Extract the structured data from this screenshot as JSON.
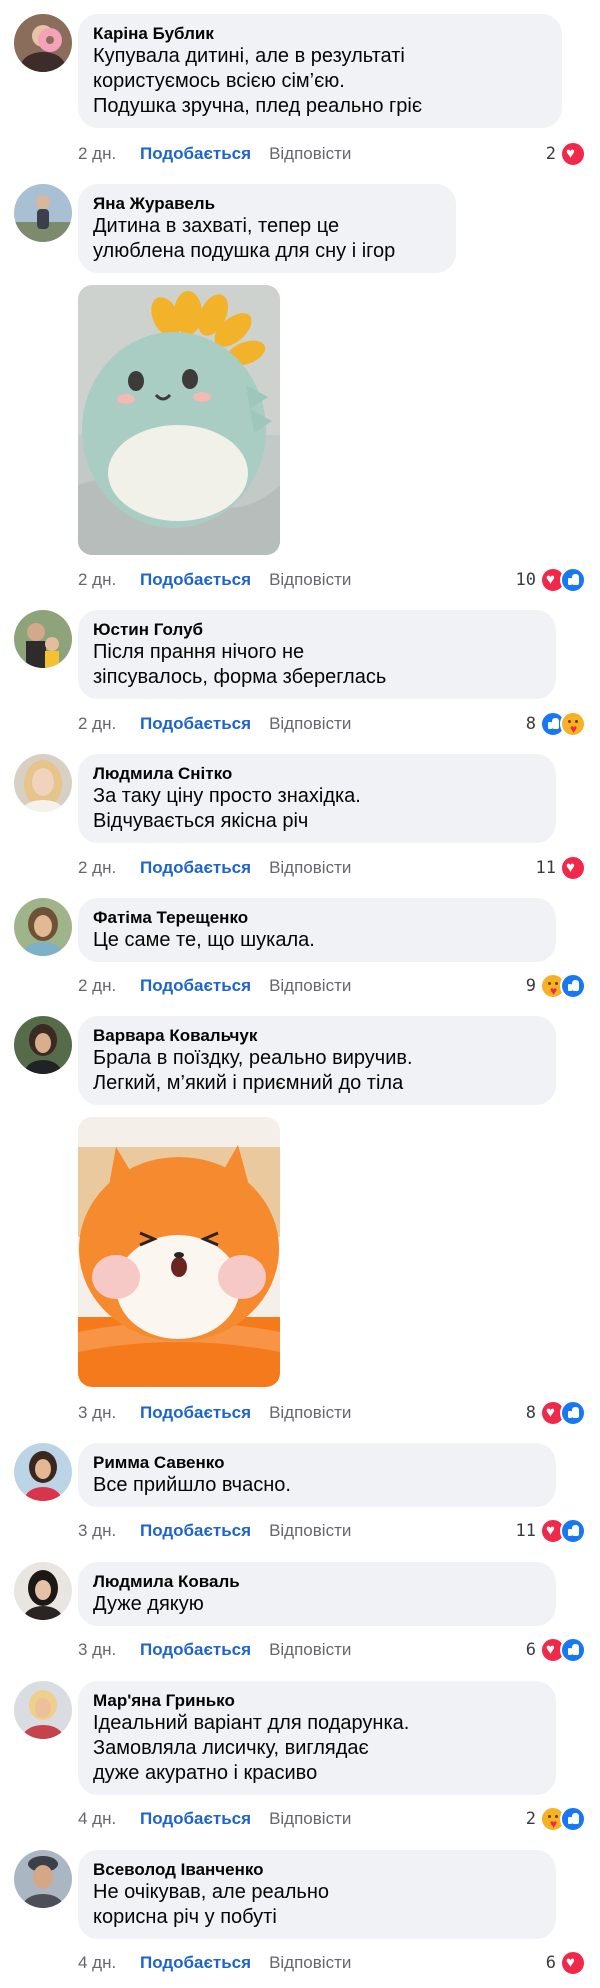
{
  "ui": {
    "like_label": "Подобається",
    "reply_label": "Відповісти"
  },
  "comments": [
    {
      "author": "Каріна Бублик",
      "lines": [
        "Купувала дитині, але в результаті",
        "користуємось всією сім’єю.",
        "Подушка зручна, плед реально гріє"
      ],
      "time": "2 дн.",
      "count": "2",
      "reactions": [
        "heart-icon"
      ]
    },
    {
      "author": "Яна Журавель",
      "lines": [
        "Дитина в захваті, тепер це",
        "улюблена подушка для сну і ігор"
      ],
      "time": "2 дн.",
      "count": "10",
      "reactions": [
        "heart-icon",
        "like-icon"
      ],
      "photo": "mint-dinosaur-plush"
    },
    {
      "author": "Юстин Голуб",
      "lines": [
        "Після прання нічого не",
        "зіпсувалось, форма збереглась"
      ],
      "time": "2 дн.",
      "count": "8",
      "reactions": [
        "like-icon",
        "care-icon"
      ]
    },
    {
      "author": "Людмила Снітко",
      "lines": [
        "За таку ціну просто знахідка.",
        "Відчувається якісна річ"
      ],
      "time": "2 дн.",
      "count": "11",
      "reactions": [
        "heart-icon"
      ]
    },
    {
      "author": "Фатіма Терещенко",
      "lines": [
        "Це саме те, що шукала."
      ],
      "time": "2 дн.",
      "count": "9",
      "reactions": [
        "care-icon",
        "like-icon"
      ]
    },
    {
      "author": "Варвара Ковальчук",
      "lines": [
        "Брала в поїздку, реально виручив.",
        "Легкий, м’який і приємний до тіла"
      ],
      "time": "3 дн.",
      "count": "8",
      "reactions": [
        "heart-icon",
        "like-icon"
      ],
      "photo": "orange-fox-plush"
    },
    {
      "author": "Римма Савенко",
      "lines": [
        "Все прийшло вчасно."
      ],
      "time": "3 дн.",
      "count": "11",
      "reactions": [
        "heart-icon",
        "like-icon"
      ]
    },
    {
      "author": "Людмила Коваль",
      "lines": [
        "Дуже дякую"
      ],
      "time": "3 дн.",
      "count": "6",
      "reactions": [
        "heart-icon",
        "like-icon"
      ]
    },
    {
      "author": "Мар'яна Гринько",
      "lines": [
        "Ідеальний варіант для подарунка.",
        "Замовляла лисичку, виглядає",
        "дуже акуратно і красиво"
      ],
      "time": "4 дн.",
      "count": "2",
      "reactions": [
        "care-icon",
        "like-icon"
      ]
    },
    {
      "author": "Всеволод Іванченко",
      "lines": [
        "Не очікував, але реально",
        "корисна річ у побуті"
      ],
      "time": "4 дн.",
      "count": "6",
      "reactions": [
        "heart-icon"
      ]
    }
  ],
  "colors": {
    "bubble": "#f0f2f5",
    "like_text": "#1d65c8",
    "meta_text": "#65676b",
    "heart": "#f02849",
    "like": "#1877f2",
    "care": "#f7b125"
  }
}
